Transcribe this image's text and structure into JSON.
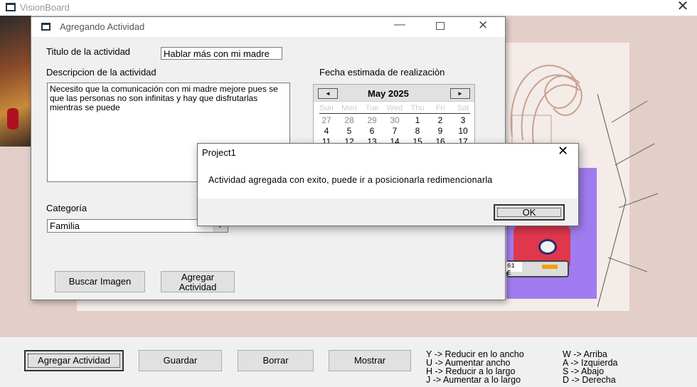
{
  "app": {
    "title": "VisionBoard"
  },
  "bottom": {
    "add_label": "Agregar Actividad",
    "save_label": "Guardar",
    "delete_label": "Borrar",
    "show_label": "Mostrar",
    "keys_left": [
      "Y -> Reducir en lo ancho",
      "U -> Aumentar ancho",
      "H -> Reducir a lo largo",
      "J -> Aumentar a lo largo"
    ],
    "keys_right": [
      "W -> Arriba",
      "A -> Izquierda",
      "S -> Abajo",
      "D -> Derecha"
    ]
  },
  "dialog": {
    "title": "Agregando Actividad",
    "title_label": "Titulo de la actividad",
    "title_value": "Hablar más con mi madre",
    "desc_label": "Descripcion de la actividad",
    "desc_value": "Necesito que la comunicación con mi madre mejore pues se que las personas no son infinitas y hay que disfrutarlas mientras se puede",
    "date_label": "Fecha estimada de realizaciòn",
    "category_label": "Categoría",
    "category_value": "Familia",
    "search_image_label": "Buscar Imagen",
    "add_activity_label": "Agregar\nActividad"
  },
  "calendar": {
    "month": "May 2025",
    "prev": "◄",
    "next": "►",
    "dow": [
      "Sun",
      "Mon",
      "Tue",
      "Wed",
      "Thu",
      "Fri",
      "Sat"
    ],
    "weeks": [
      [
        "27",
        "28",
        "29",
        "30",
        "1",
        "2",
        "3"
      ],
      [
        "4",
        "5",
        "6",
        "7",
        "8",
        "9",
        "10"
      ],
      [
        "11",
        "12",
        "13",
        "14",
        "15",
        "16",
        "17"
      ]
    ]
  },
  "message": {
    "title": "Project1",
    "text": "Actividad agregada con exito, puede ir a posicionarla redimencionarla",
    "ok_label": "OK"
  },
  "plate": {
    "text": "61 E"
  },
  "colors": {
    "board": "#e4cec9",
    "purple": "#a07cf0",
    "car": "#e0374d"
  }
}
